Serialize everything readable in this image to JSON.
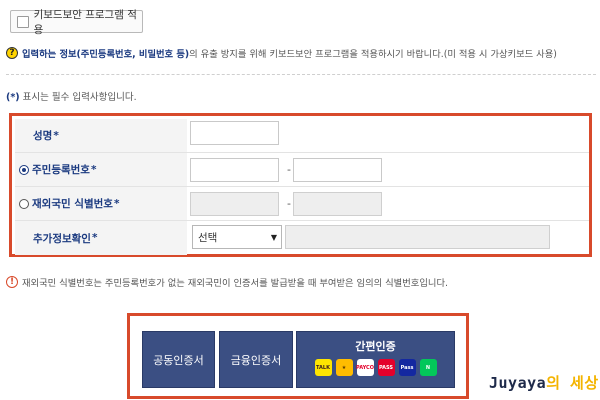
{
  "keyboard_button": {
    "label": "키보드보안 프로그램 적용"
  },
  "notice": {
    "icon": "question-circle-icon",
    "text_bold": "입력하는 정보(주민등록번호, 비밀번호 등)",
    "text_rest": "의 유출 방지를 위해 키보드보안 프로그램을 적용하시기 바랍니다.(미 적용 시 가상키보드 사용)"
  },
  "required_note": {
    "star": "(*)",
    "text": " 표시는 필수 입력사항입니다."
  },
  "form": {
    "name_label": "성명",
    "rrn_label": "주민등록번호",
    "foreign_label": "재외국민 식별번호",
    "extra_label": "추가정보확인",
    "star": "*",
    "dash": "-",
    "select_value": "선택"
  },
  "warning": {
    "icon": "exclamation-circle-icon",
    "text": "재외국민 식별번호는 주민등록번호가 없는 재외국민이 인증서를 발급받을 때 부여받은 임의의 식별번호입니다."
  },
  "cert": {
    "public_label": "공동인증서",
    "finance_label": "금융인증서",
    "simple_label": "간편인증",
    "icons": [
      {
        "name": "kakao-icon",
        "text": "TALK",
        "bg": "#fee500",
        "fg": "#3a1d1d"
      },
      {
        "name": "kb-icon",
        "text": "★",
        "bg": "#ffbc00",
        "fg": "#5a3b00"
      },
      {
        "name": "payco-icon",
        "text": "PAYCO",
        "bg": "#ffffff",
        "fg": "#e4002b"
      },
      {
        "name": "pass-icon",
        "text": "PASS",
        "bg": "#e4002b",
        "fg": "#ffffff"
      },
      {
        "name": "samsung-pass-icon",
        "text": "Pass",
        "bg": "#1428a0",
        "fg": "#ffffff"
      },
      {
        "name": "naver-icon",
        "text": "N",
        "bg": "#03c75a",
        "fg": "#ffffff"
      }
    ]
  },
  "watermark": {
    "prefix": "Juyaya",
    "suffix": "의 세상"
  },
  "colors": {
    "accent_blue": "#1b3a80",
    "highlight_red": "#d84a2b",
    "button_navy": "#3b4f83"
  }
}
